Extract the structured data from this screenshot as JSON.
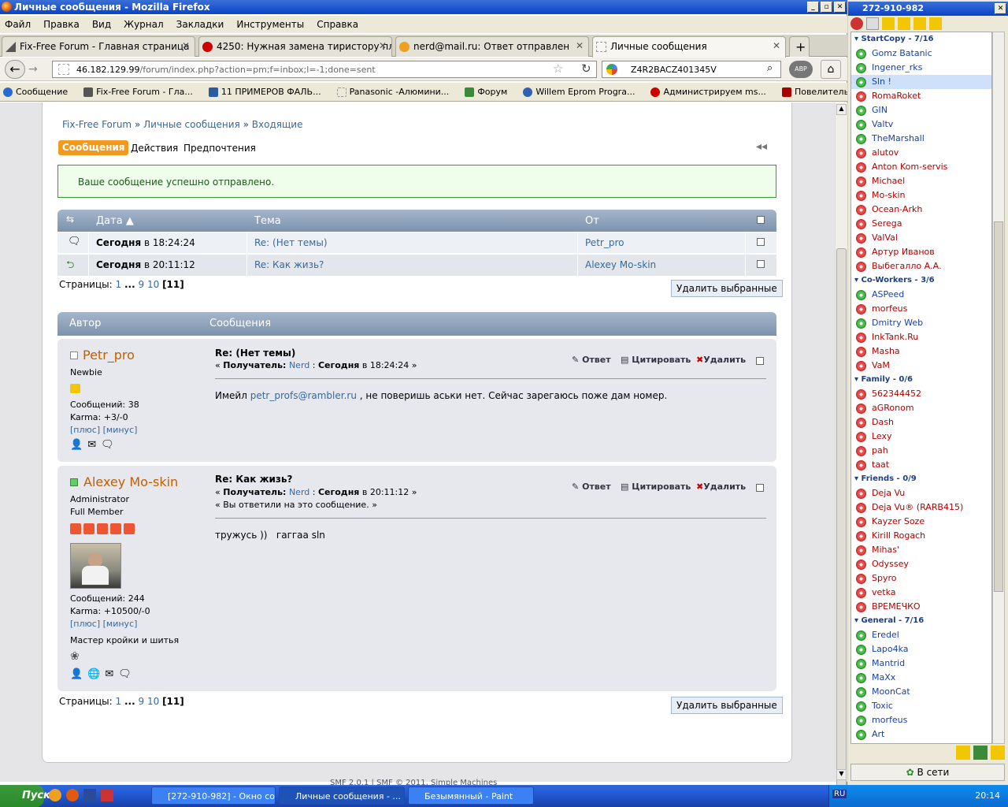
{
  "window": {
    "title": "Личные сообщения - Mozilla Firefox"
  },
  "menu": [
    "Файл",
    "Правка",
    "Вид",
    "Журнал",
    "Закладки",
    "Инструменты",
    "Справка"
  ],
  "tabs": [
    {
      "label": "Fix-Free Forum - Главная страница"
    },
    {
      "label": "4250: Нужная замена тиристору плат..."
    },
    {
      "label": "nerd@mail.ru: Ответ отправлен"
    },
    {
      "label": "Личные сообщения"
    }
  ],
  "url": {
    "host": "46.182.129.99",
    "path": "/forum/index.php?action=pm;f=inbox;l=-1;done=sent"
  },
  "search": {
    "value": "Z4R2BACZ401345V"
  },
  "bookmarks": [
    "Сообщение",
    "Fix-Free Forum - Гла...",
    "11 ПРИМЕРОВ ФАЛЬ...",
    "Panasonic -Алюмини...",
    "Форум",
    "Willem Eprom Progra...",
    "Администрируем ms...",
    "Повелитель табуре..."
  ],
  "forum": {
    "breadcrumb": [
      "Fix-Free Forum",
      "Личные сообщения",
      "Входящие"
    ],
    "sep": "»",
    "tabs": {
      "messages": "Сообщения",
      "actions": "Действия",
      "prefs": "Предпочтения"
    },
    "notice": "Ваше сообщение успешно отправлено.",
    "table": {
      "headers": {
        "date": "Дата",
        "subject": "Тема",
        "from": "От"
      },
      "rows": [
        {
          "date_bold": "Сегодня",
          "date_rest": "в 18:24:24",
          "subject": "Re: (Нет темы)",
          "from": "Petr_pro"
        },
        {
          "date_bold": "Сегодня",
          "date_rest": "в 20:11:12",
          "subject": "Re: Как жизь?",
          "from": "Alexey Mo-skin"
        }
      ]
    },
    "pages": {
      "label": "Страницы:",
      "p1": "1",
      "dots": "...",
      "p9": "9",
      "p10": "10",
      "current": "[11]"
    },
    "delete_selected": "Удалить выбранные",
    "posts_header": {
      "author": "Автор",
      "messages": "Сообщения"
    },
    "posts": [
      {
        "author": "Petr_pro",
        "rank": "Newbie",
        "posts": "Сообщений: 38",
        "karma": "Karma: +3/-0",
        "plus": "[плюс]",
        "minus": "[минус]",
        "subject": "Re: (Нет темы)",
        "to_label": "Получатель:",
        "to": "Nerd",
        "date_bold": "Сегодня",
        "date_rest": "в 18:24:24",
        "body_pre": "Имейл ",
        "body_link": "petr_profs@rambler.ru",
        "body_post": " , не поверишь аськи нет. Сейчас зарегаюсь поже дам номер."
      },
      {
        "author": "Alexey Mo-skin",
        "rank": "Administrator",
        "rank2": "Full Member",
        "posts": "Сообщений: 244",
        "karma": "Karma: +10500/-0",
        "plus": "[плюс]",
        "minus": "[минус]",
        "title": "Мастер кройки и шитья",
        "subject": "Re: Как жизь?",
        "to_label": "Получатель:",
        "to": "Nerd",
        "date_bold": "Сегодня",
        "date_rest": "в 20:11:12",
        "replied": "« Вы ответили на это сообщение. »",
        "body": "тружусь ))   гаггаа sln"
      }
    ],
    "post_actions": {
      "reply": "Ответ",
      "quote": "Цитировать",
      "delete": "Удалить"
    },
    "footer": "SMF 2.0.1 | SMF © 2011, Simple Machines"
  },
  "icq": {
    "title": "272-910-982",
    "status": "В сети",
    "groups": [
      {
        "name": "StartCopy - 7/16",
        "contacts": [
          {
            "n": "Gomz Batanic",
            "on": true
          },
          {
            "n": "Ingener_rks",
            "on": true
          },
          {
            "n": "Sln !",
            "on": true
          },
          {
            "n": "RomaRoket",
            "on": false
          },
          {
            "n": "GIN",
            "on": true
          },
          {
            "n": "Valtv",
            "on": true
          },
          {
            "n": "TheMarshall",
            "on": true
          },
          {
            "n": "alutov",
            "on": false
          },
          {
            "n": "Anton Kom-servis",
            "on": false
          },
          {
            "n": "Michael",
            "on": false
          },
          {
            "n": "Mo-skin",
            "on": false
          },
          {
            "n": "Ocean-Arkh",
            "on": false
          },
          {
            "n": "Serega",
            "on": false
          },
          {
            "n": "ValVal",
            "on": false
          },
          {
            "n": "Артур Иванов",
            "on": false
          },
          {
            "n": "Выбегалло А.А.",
            "on": false
          }
        ]
      },
      {
        "name": "Co-Workers - 3/6",
        "contacts": [
          {
            "n": "ASPeed",
            "on": true
          },
          {
            "n": "morfeus",
            "on": false
          },
          {
            "n": "Dmitry Web",
            "on": true
          },
          {
            "n": "InkTank.Ru",
            "on": false
          },
          {
            "n": "Masha",
            "on": false
          },
          {
            "n": "VaM",
            "on": false
          }
        ]
      },
      {
        "name": "Family - 0/6",
        "contacts": [
          {
            "n": "562344452",
            "on": false
          },
          {
            "n": "aGRonom",
            "on": false
          },
          {
            "n": "Dash",
            "on": false
          },
          {
            "n": "Lexy",
            "on": false
          },
          {
            "n": "pah",
            "on": false
          },
          {
            "n": "taat",
            "on": false
          }
        ]
      },
      {
        "name": "Friends - 0/9",
        "contacts": [
          {
            "n": "Deja Vu",
            "on": false
          },
          {
            "n": "Deja Vu® (RARB415)",
            "on": false
          },
          {
            "n": "Kayzer Soze",
            "on": false
          },
          {
            "n": "Kirill Rogach",
            "on": false
          },
          {
            "n": "Mihas'",
            "on": false
          },
          {
            "n": "Odyssey",
            "on": false
          },
          {
            "n": "Spyro",
            "on": false
          },
          {
            "n": "vetka",
            "on": false
          },
          {
            "n": "ВРЕМЕЧКО",
            "on": false
          }
        ]
      },
      {
        "name": "General - 7/16",
        "contacts": [
          {
            "n": "Eredel",
            "on": true
          },
          {
            "n": "Lapo4ka",
            "on": true
          },
          {
            "n": "Mantrid",
            "on": true
          },
          {
            "n": "MaXx",
            "on": true
          },
          {
            "n": "MoonCat",
            "on": true
          },
          {
            "n": "Toxic",
            "on": true
          },
          {
            "n": "morfeus",
            "on": true
          },
          {
            "n": "Art",
            "on": true
          }
        ]
      }
    ]
  },
  "taskbar": {
    "start": "Пуск",
    "tasks": [
      "[272-910-982] - Окно со...",
      "Личные сообщения - ...",
      "Безымянный - Paint"
    ],
    "lang": "RU",
    "time": "20:14"
  }
}
